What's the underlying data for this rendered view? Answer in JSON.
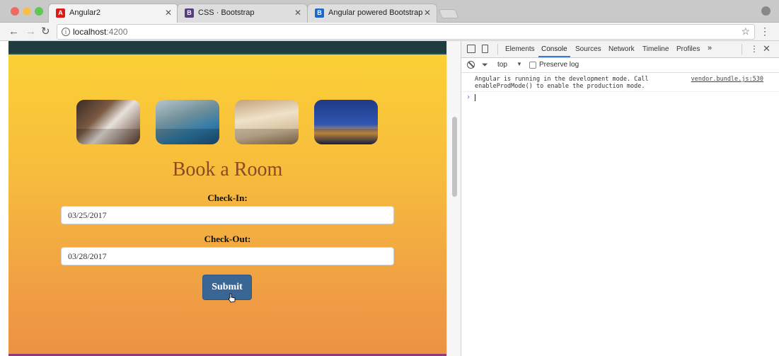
{
  "browser": {
    "tabs": [
      {
        "title": "Angular2",
        "favicon": "A",
        "favicon_color": "#dd1b16",
        "active": true
      },
      {
        "title": "CSS · Bootstrap",
        "favicon": "B",
        "favicon_color": "#563d7c",
        "active": false
      },
      {
        "title": "Angular powered Bootstrap",
        "favicon": "B",
        "favicon_color": "#1b6ac9",
        "active": false
      }
    ],
    "close_glyph": "✕",
    "url_host": "localhost",
    "url_port": ":4200",
    "back_glyph": "←",
    "forward_glyph": "→",
    "reload_glyph": "↻",
    "star_glyph": "☆",
    "menu_glyph": "⋮",
    "info_glyph": "i"
  },
  "page": {
    "gallery": [
      {
        "name": "hotel-bedroom-photo"
      },
      {
        "name": "indoor-pool-photo"
      },
      {
        "name": "dining-hall-photo"
      },
      {
        "name": "london-night-skyline-photo"
      }
    ],
    "heading": "Book a Room",
    "checkin_label": "Check-In:",
    "checkin_value": "03/25/2017",
    "checkout_label": "Check-Out:",
    "checkout_value": "03/28/2017",
    "submit_label": "Submit"
  },
  "devtools": {
    "tabs": [
      "Elements",
      "Console",
      "Sources",
      "Network",
      "Timeline",
      "Profiles"
    ],
    "active_tab": "Console",
    "more_glyph": "»",
    "kebab_glyph": "⋮",
    "close_glyph": "✕",
    "filter_glyph": "⏷",
    "context": "top",
    "context_caret": "▼",
    "preserve_log_label": "Preserve log",
    "messages": [
      {
        "text": "Angular is running in the development mode. Call\nenableProdMode() to enable the production mode.",
        "source": "vendor.bundle.js:530"
      }
    ],
    "prompt_glyph": "›"
  }
}
